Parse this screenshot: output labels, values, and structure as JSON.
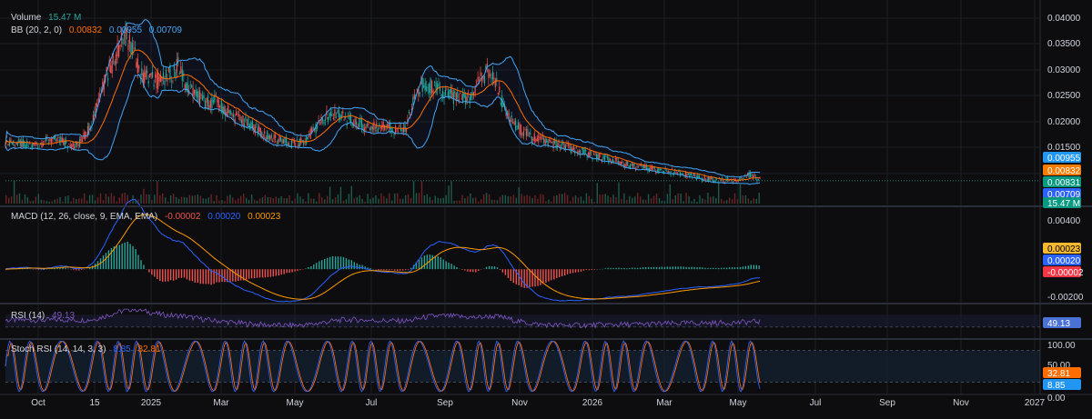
{
  "colors": {
    "background": "#0d0d0f",
    "grid": "#1c1e24",
    "text": "#d1d4dc",
    "axis_text": "#d1d4dc",
    "separator": "#2a2e39",
    "candle_up": "#26a69a",
    "candle_down": "#ef5350",
    "bb_basis": "#ff6d00",
    "bb_band": "#2962ff",
    "bb_band_light": "#42a5f5",
    "volume_up": "#1e5a4a",
    "volume_down": "#6b2426",
    "macd_line": "#2962ff",
    "signal_line": "#ff9800",
    "hist_up": "#26a69a",
    "hist_down": "#ef5350",
    "rsi_line": "#7e57c2",
    "rsi_band": "#1a1d33",
    "stoch_k": "#2962ff",
    "stoch_d": "#ff6d00",
    "stoch_band": "#14202e",
    "tag_bb_upper": "#2196f3",
    "tag_bb_basis": "#f57c00",
    "tag_price": "#089981",
    "tag_bb_lower": "#2962ff",
    "tag_macd_signal": "#f5b82e",
    "tag_macd": "#2962ff",
    "tag_hist": "#f23645",
    "tag_rsi": "#4a72d6",
    "tag_stoch_d": "#ff6d00",
    "tag_stoch_k": "#2196f3"
  },
  "legend": {
    "volume": {
      "name": "Volume",
      "value": "15.47 M"
    },
    "bb": {
      "name": "BB (20, 2, 0)",
      "basis": "0.00832",
      "upper": "0.00955",
      "lower": "0.00709"
    },
    "macd": {
      "name": "MACD (12, 26, close, 9, EMA, EMA)",
      "hist": "-0.00002",
      "macd": "0.00020",
      "signal": "0.00023"
    },
    "rsi": {
      "name": "RSI (14)",
      "value": "49.13"
    },
    "stoch": {
      "name": "Stoch RSI (14, 14, 3, 3)",
      "k": "8.85",
      "d": "32.81"
    }
  },
  "price_axis": [
    "0.04000",
    "0.03500",
    "0.03000",
    "0.02500",
    "0.02000",
    "0.01500"
  ],
  "price_tags": {
    "bb_upper": "0.00955",
    "bb_basis": "0.00832",
    "price": "0.00831",
    "bb_lower": "0.00709",
    "volume": "15.47 M"
  },
  "macd_axis": [
    "0.00400",
    "-0.00200"
  ],
  "macd_tags": {
    "signal": "0.00023",
    "macd": "0.00020",
    "hist": "-0.00002"
  },
  "rsi_tag": "49.13",
  "stoch_axis": [
    "100.00",
    "50.00",
    "0.00"
  ],
  "stoch_tags": {
    "d": "32.81",
    "k": "8.85"
  },
  "time_axis": [
    "Oct",
    "15",
    "2025",
    "Mar",
    "May",
    "Jul",
    "Sep",
    "Nov",
    "2026",
    "Mar",
    "May",
    "Jul",
    "Sep",
    "Nov",
    "2027"
  ],
  "chart_data": {
    "type": "line",
    "title": "",
    "panes": [
      "price",
      "macd",
      "rsi",
      "stoch_rsi"
    ],
    "price_series": [
      {
        "name": "BB (20, 2, 0)",
        "last_basis": 0.00832,
        "last_upper": 0.00955,
        "last_lower": 0.00709
      },
      {
        "name": "Price",
        "last": 0.00831
      },
      {
        "name": "Volume",
        "last": "15.47 M"
      }
    ],
    "approx_close": [
      0.016,
      0.0155,
      0.0152,
      0.0148,
      0.0155,
      0.016,
      0.0158,
      0.0152,
      0.015,
      0.0175,
      0.022,
      0.028,
      0.031,
      0.036,
      0.033,
      0.028,
      0.0275,
      0.027,
      0.028,
      0.03,
      0.026,
      0.0245,
      0.023,
      0.0235,
      0.022,
      0.0205,
      0.0195,
      0.019,
      0.0175,
      0.0165,
      0.016,
      0.0155,
      0.0152,
      0.016,
      0.018,
      0.02,
      0.021,
      0.0205,
      0.0195,
      0.019,
      0.0185,
      0.0182,
      0.019,
      0.0175,
      0.018,
      0.024,
      0.0265,
      0.026,
      0.025,
      0.0245,
      0.0235,
      0.024,
      0.0265,
      0.029,
      0.027,
      0.021,
      0.019,
      0.0175,
      0.0165,
      0.016,
      0.0155,
      0.015,
      0.0145,
      0.014,
      0.0135,
      0.013,
      0.0125,
      0.012,
      0.0115,
      0.011,
      0.0108,
      0.0105,
      0.0102,
      0.01,
      0.0098,
      0.0094,
      0.009,
      0.0087,
      0.0085,
      0.0084,
      0.0085,
      0.0088,
      0.0095,
      0.0083
    ],
    "y_range": [
      0.004,
      0.041
    ],
    "macd_range": [
      -0.0022,
      0.0043
    ],
    "rsi_range": [
      0,
      100
    ],
    "stoch_range": [
      0,
      100
    ],
    "time_labels": [
      "Oct",
      "15",
      "2025",
      "Mar",
      "May",
      "Jul",
      "Sep",
      "Nov",
      "2026",
      "Mar",
      "May",
      "Jul",
      "Sep",
      "Nov",
      "2027"
    ],
    "grid": true
  }
}
